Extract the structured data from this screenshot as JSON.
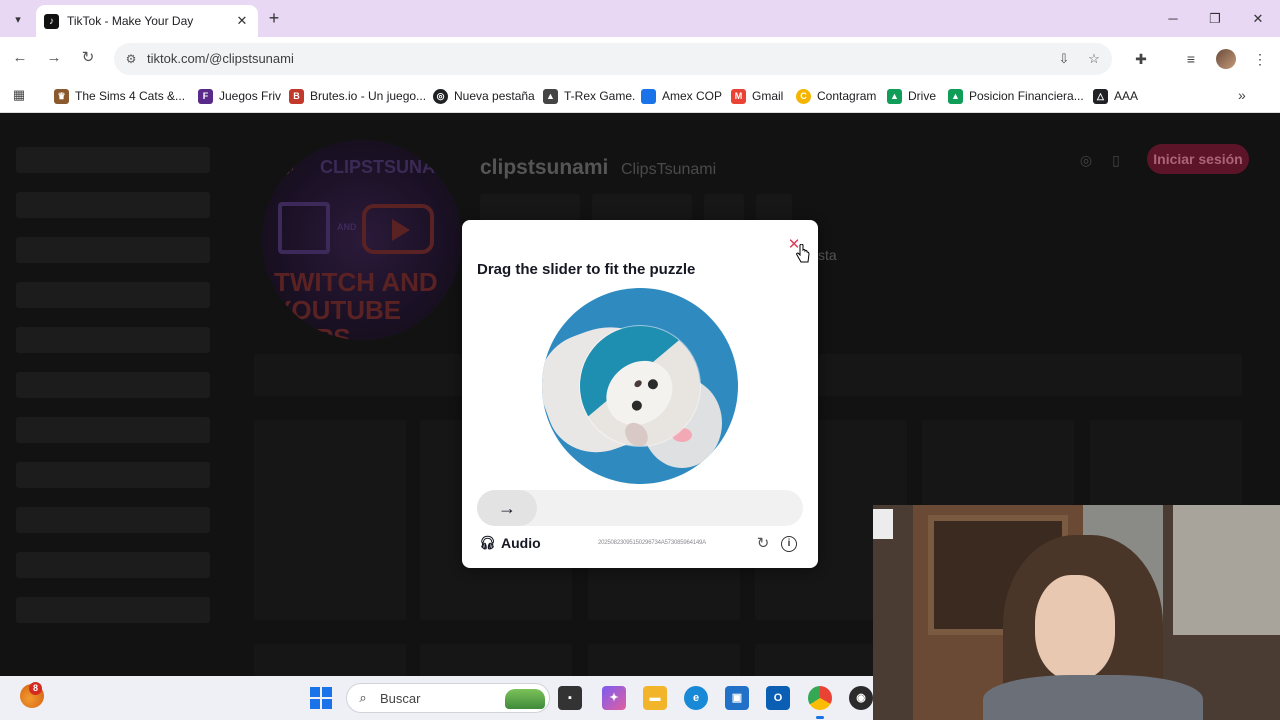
{
  "browser": {
    "tab_title": "TikTok - Make Your Day",
    "url": "tiktok.com/@clipstsunami",
    "bookmarks": [
      {
        "label": "The Sims 4 Cats &...",
        "color": "#8a5a2e",
        "icon": "sims-icon"
      },
      {
        "label": "Juegos Friv",
        "color": "#5a2a8a",
        "icon": "friv-icon"
      },
      {
        "label": "Brutes.io - Un juego...",
        "color": "#c0392b",
        "icon": "brutes-icon"
      },
      {
        "label": "Nueva pestaña",
        "color": "#202124",
        "icon": "globe-icon"
      },
      {
        "label": "T-Rex Game.",
        "color": "#444444",
        "icon": "dino-icon"
      },
      {
        "label": "Amex COP",
        "color": "#1a73e8",
        "icon": "amex-icon"
      },
      {
        "label": "Gmail",
        "color": "#ea4335",
        "icon": "gmail-icon"
      },
      {
        "label": "Contagram",
        "color": "#f4b400",
        "icon": "contagram-icon"
      },
      {
        "label": "Drive",
        "color": "#0f9d58",
        "icon": "drive-icon"
      },
      {
        "label": "Posicion Financiera...",
        "color": "#0f9d58",
        "icon": "drive-icon"
      },
      {
        "label": "AAA",
        "color": "#202124",
        "icon": "triangle-icon"
      }
    ]
  },
  "profile": {
    "username": "clipstsunami",
    "nickname": "ClipsTsunami",
    "avatar_text_top": "CLIPSTSUNAMI",
    "avatar_text_bottom": "TWITCH AND YOUTUBE CLIPS",
    "avatar_and": "AND",
    "partial_text": "sta",
    "login_label": "Iniciar sesión"
  },
  "captcha": {
    "title": "Drag the slider to fit the puzzle",
    "audio_label": "Audio",
    "captcha_id": "20250823095150296734A573085964149A",
    "accent": "#e23c5a"
  },
  "taskbar": {
    "search_placeholder": "Buscar",
    "widget_badge": "8"
  }
}
